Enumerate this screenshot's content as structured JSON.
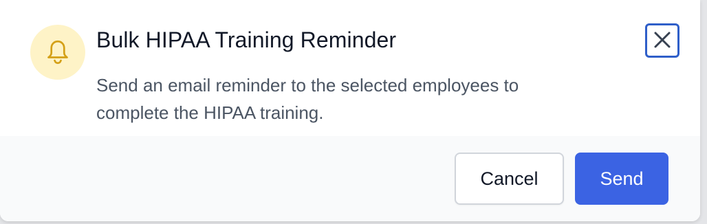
{
  "dialog": {
    "title": "Bulk HIPAA Training Reminder",
    "description": "Send an email reminder to the selected employees to complete the HIPAA training.",
    "icon": "bell-icon",
    "close_icon": "close-icon",
    "accent_color": "#3b63e3",
    "icon_bg_color": "#fef3c7",
    "icon_color": "#d4a017"
  },
  "footer": {
    "cancel_label": "Cancel",
    "send_label": "Send"
  }
}
